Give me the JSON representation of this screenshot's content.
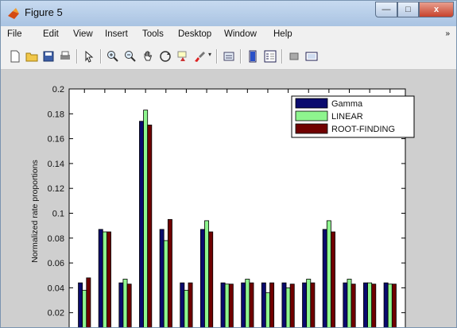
{
  "window": {
    "title": "Figure 5"
  },
  "menu": [
    "File",
    "Edit",
    "View",
    "Insert",
    "Tools",
    "Desktop",
    "Window",
    "Help"
  ],
  "menu_overflow": "»",
  "toolbar": {
    "icons": [
      "new-figure-icon",
      "open-file-icon",
      "save-icon",
      "print-icon",
      "pointer-icon",
      "zoom-in-icon",
      "zoom-out-icon",
      "pan-icon",
      "rotate-3d-icon",
      "data-cursor-icon",
      "brush-icon",
      "link-plot-icon",
      "colorbar-icon",
      "legend-icon",
      "hide-plot-tools-icon",
      "show-plot-tools-icon"
    ]
  },
  "colors": {
    "gamma": "#0a0a6e",
    "linear": "#8ef58e",
    "root_finding": "#700000",
    "figure_bg": "#cfcfcf"
  },
  "chart_data": {
    "type": "bar",
    "ylabel": "Normalized rate proportions",
    "ylim": [
      0,
      0.2
    ],
    "yticks": [
      "0.02",
      "0.04",
      "0.06",
      "0.08",
      "0.1",
      "0.12",
      "0.14",
      "0.16",
      "0.18",
      "0.2"
    ],
    "legend_placement": "top-right",
    "series": [
      {
        "name": "Gamma",
        "values": [
          0.044,
          0.087,
          0.044,
          0.174,
          0.087,
          0.044,
          0.087,
          0.044,
          0.044,
          0.044,
          0.044,
          0.044,
          0.087,
          0.044,
          0.044,
          0.044
        ]
      },
      {
        "name": "LINEAR",
        "values": [
          0.038,
          0.085,
          0.047,
          0.183,
          0.078,
          0.038,
          0.094,
          0.043,
          0.047,
          0.036,
          0.04,
          0.047,
          0.094,
          0.047,
          0.044,
          0.043
        ]
      },
      {
        "name": "ROOT-FINDING",
        "values": [
          0.048,
          0.085,
          0.043,
          0.171,
          0.095,
          0.044,
          0.085,
          0.043,
          0.044,
          0.044,
          0.043,
          0.044,
          0.085,
          0.043,
          0.043,
          0.043
        ]
      }
    ]
  }
}
